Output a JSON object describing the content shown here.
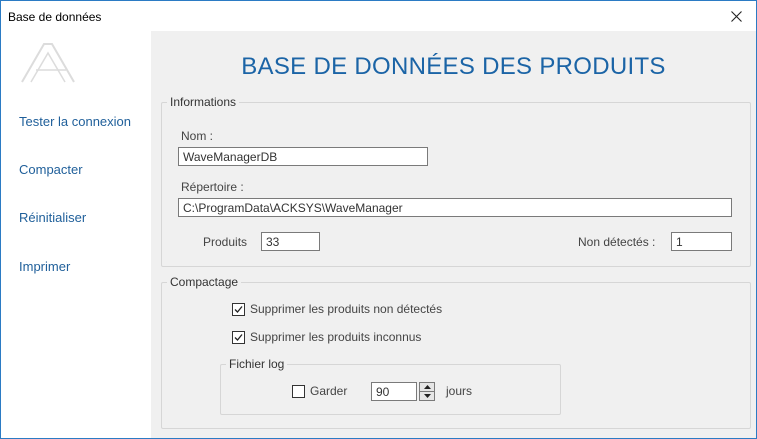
{
  "window": {
    "title": "Base de données"
  },
  "header": {
    "heading": "BASE DE DONNÉES DES PRODUITS"
  },
  "sidebar": {
    "items": [
      {
        "label": "Tester la connexion"
      },
      {
        "label": "Compacter"
      },
      {
        "label": "Réinitialiser"
      },
      {
        "label": "Imprimer"
      }
    ]
  },
  "informations": {
    "legend": "Informations",
    "name_label": "Nom :",
    "name_value": "WaveManagerDB",
    "directory_label": "Répertoire :",
    "directory_value": "C:\\ProgramData\\ACKSYS\\WaveManager",
    "products_label": "Produits",
    "products_value": "33",
    "not_detected_label": "Non détectés :",
    "not_detected_value": "1"
  },
  "compactage": {
    "legend": "Compactage",
    "delete_undetected_label": "Supprimer les produits non détectés",
    "delete_undetected_checked": true,
    "delete_unknown_label": "Supprimer les produits inconnus",
    "delete_unknown_checked": true,
    "log": {
      "legend": "Fichier log",
      "keep_label": "Garder",
      "keep_checked": false,
      "days_value": "90",
      "days_unit": "jours"
    }
  },
  "icons": {
    "close": "close-icon",
    "logo": "logo-icon",
    "check": "checkmark-icon",
    "spin_up": "arrow-up-icon",
    "spin_down": "arrow-down-icon"
  },
  "colors": {
    "accent": "#1b64a6",
    "nav_link": "#1f5f9a",
    "window_border": "#2b7bc4",
    "panel_bg": "#f0f0f0"
  }
}
